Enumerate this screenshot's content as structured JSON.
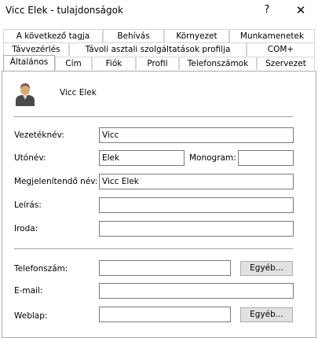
{
  "window": {
    "title": "Vicc Elek - tulajdonságok",
    "help": "?",
    "close": "✕"
  },
  "tabs": {
    "row1": [
      "A következő tagja",
      "Behívás",
      "Környezet",
      "Munkamenetek"
    ],
    "row2": [
      "Távvezérlés",
      "Távoli asztali szolgáltatások profilja",
      "COM+"
    ],
    "row3": [
      "Általános",
      "Cím",
      "Fiók",
      "Profil",
      "Telefonszámok",
      "Szervezet"
    ]
  },
  "general": {
    "user_icon": "user-icon",
    "display_header": "Vicc Elek",
    "first_name": {
      "label": "Vezetéknév:",
      "value": "Vicc"
    },
    "given_name": {
      "label": "Utónév:",
      "value": "Elek"
    },
    "monogram": {
      "label": "Monogram:",
      "value": ""
    },
    "display_name": {
      "label": "Megjelenítendő név:",
      "value": "Vicc Elek"
    },
    "description": {
      "label": "Leírás:",
      "value": ""
    },
    "office": {
      "label": "Iroda:",
      "value": ""
    },
    "phone": {
      "label": "Telefonszám:",
      "value": "",
      "other": "Egyéb..."
    },
    "email": {
      "label": "E-mail:",
      "value": ""
    },
    "web": {
      "label": "Weblap:",
      "value": "",
      "other": "Egyéb..."
    }
  }
}
